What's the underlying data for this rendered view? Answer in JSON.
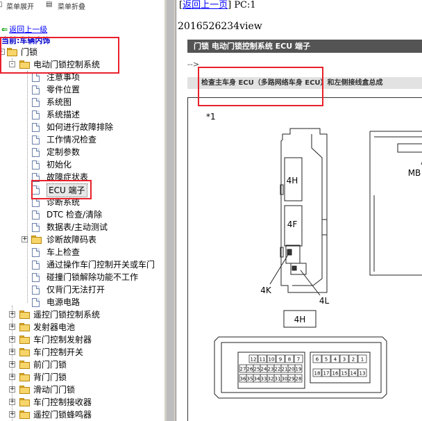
{
  "toolbar": {
    "expand_label": "菜单展开",
    "collapse_label": "菜单折叠"
  },
  "tree": {
    "back_label": "返回上一级",
    "current_label": "当前:车辆内饰",
    "root": {
      "label": "门锁"
    },
    "system": {
      "label": "电动门锁控制系统"
    },
    "children": [
      {
        "label": "注意事项"
      },
      {
        "label": "零件位置"
      },
      {
        "label": "系统图"
      },
      {
        "label": "系统描述"
      },
      {
        "label": "如何进行故障排除"
      },
      {
        "label": "工作情况检查"
      },
      {
        "label": "定制参数"
      },
      {
        "label": "初始化"
      },
      {
        "label": "故障症状表"
      },
      {
        "label": "ECU 端子",
        "selected": true
      },
      {
        "label": "诊断系统"
      },
      {
        "label": "DTC 检查/清除"
      },
      {
        "label": "数据表/主动测试"
      },
      {
        "label": "诊断故障码表",
        "expandable": true
      },
      {
        "label": "车上检查"
      },
      {
        "label": "通过操作车门控制开关或车门"
      },
      {
        "label": "碰撞门锁解除功能不工作"
      },
      {
        "label": "仅背门无法打开"
      },
      {
        "label": "电源电路"
      }
    ],
    "folders": [
      {
        "label": "遥控门锁控制系统"
      },
      {
        "label": "发射器电池"
      },
      {
        "label": "车门控制发射器"
      },
      {
        "label": "车门控制开关"
      },
      {
        "label": "前门门锁"
      },
      {
        "label": "背门门锁"
      },
      {
        "label": "滑动门门锁"
      },
      {
        "label": "车门控制接收器"
      },
      {
        "label": "遥控门锁蜂鸣器"
      }
    ]
  },
  "content": {
    "back_link": "返回上一页",
    "page_code": "PC:1",
    "doc_id": "2016526234view",
    "section_header": "门锁  电动门锁控制系统  ECU 端子",
    "arrow_text": "-->",
    "sub_header": "检查主车身 ECU（多路网络车身 ECU）和左侧接线盒总成",
    "figure": {
      "marker": "*1",
      "label_4h": "4H",
      "label_4f": "4F",
      "label_4k": "4K",
      "label_4l": "4L",
      "label_mb": "MB",
      "caption": "4H",
      "pins_left_row1": [
        "12",
        "11",
        "10",
        "9",
        "8",
        "7"
      ],
      "pins_left_row2": [
        "27",
        "26",
        "25",
        "24",
        "23",
        "22",
        "21",
        "20",
        "19"
      ],
      "pins_left_row3": [
        "36",
        "35",
        "34",
        "33",
        "32",
        "31",
        "30",
        "29",
        "28"
      ],
      "pins_right_row1": [
        "6",
        "5",
        "4",
        "3",
        "2",
        "1"
      ],
      "pins_right_row2": [
        "18",
        "17",
        "16",
        "15",
        "14",
        "13"
      ]
    }
  },
  "colors": {
    "highlight_box": "#e8202a",
    "section_band": "#545454",
    "link": "#0000ff"
  }
}
